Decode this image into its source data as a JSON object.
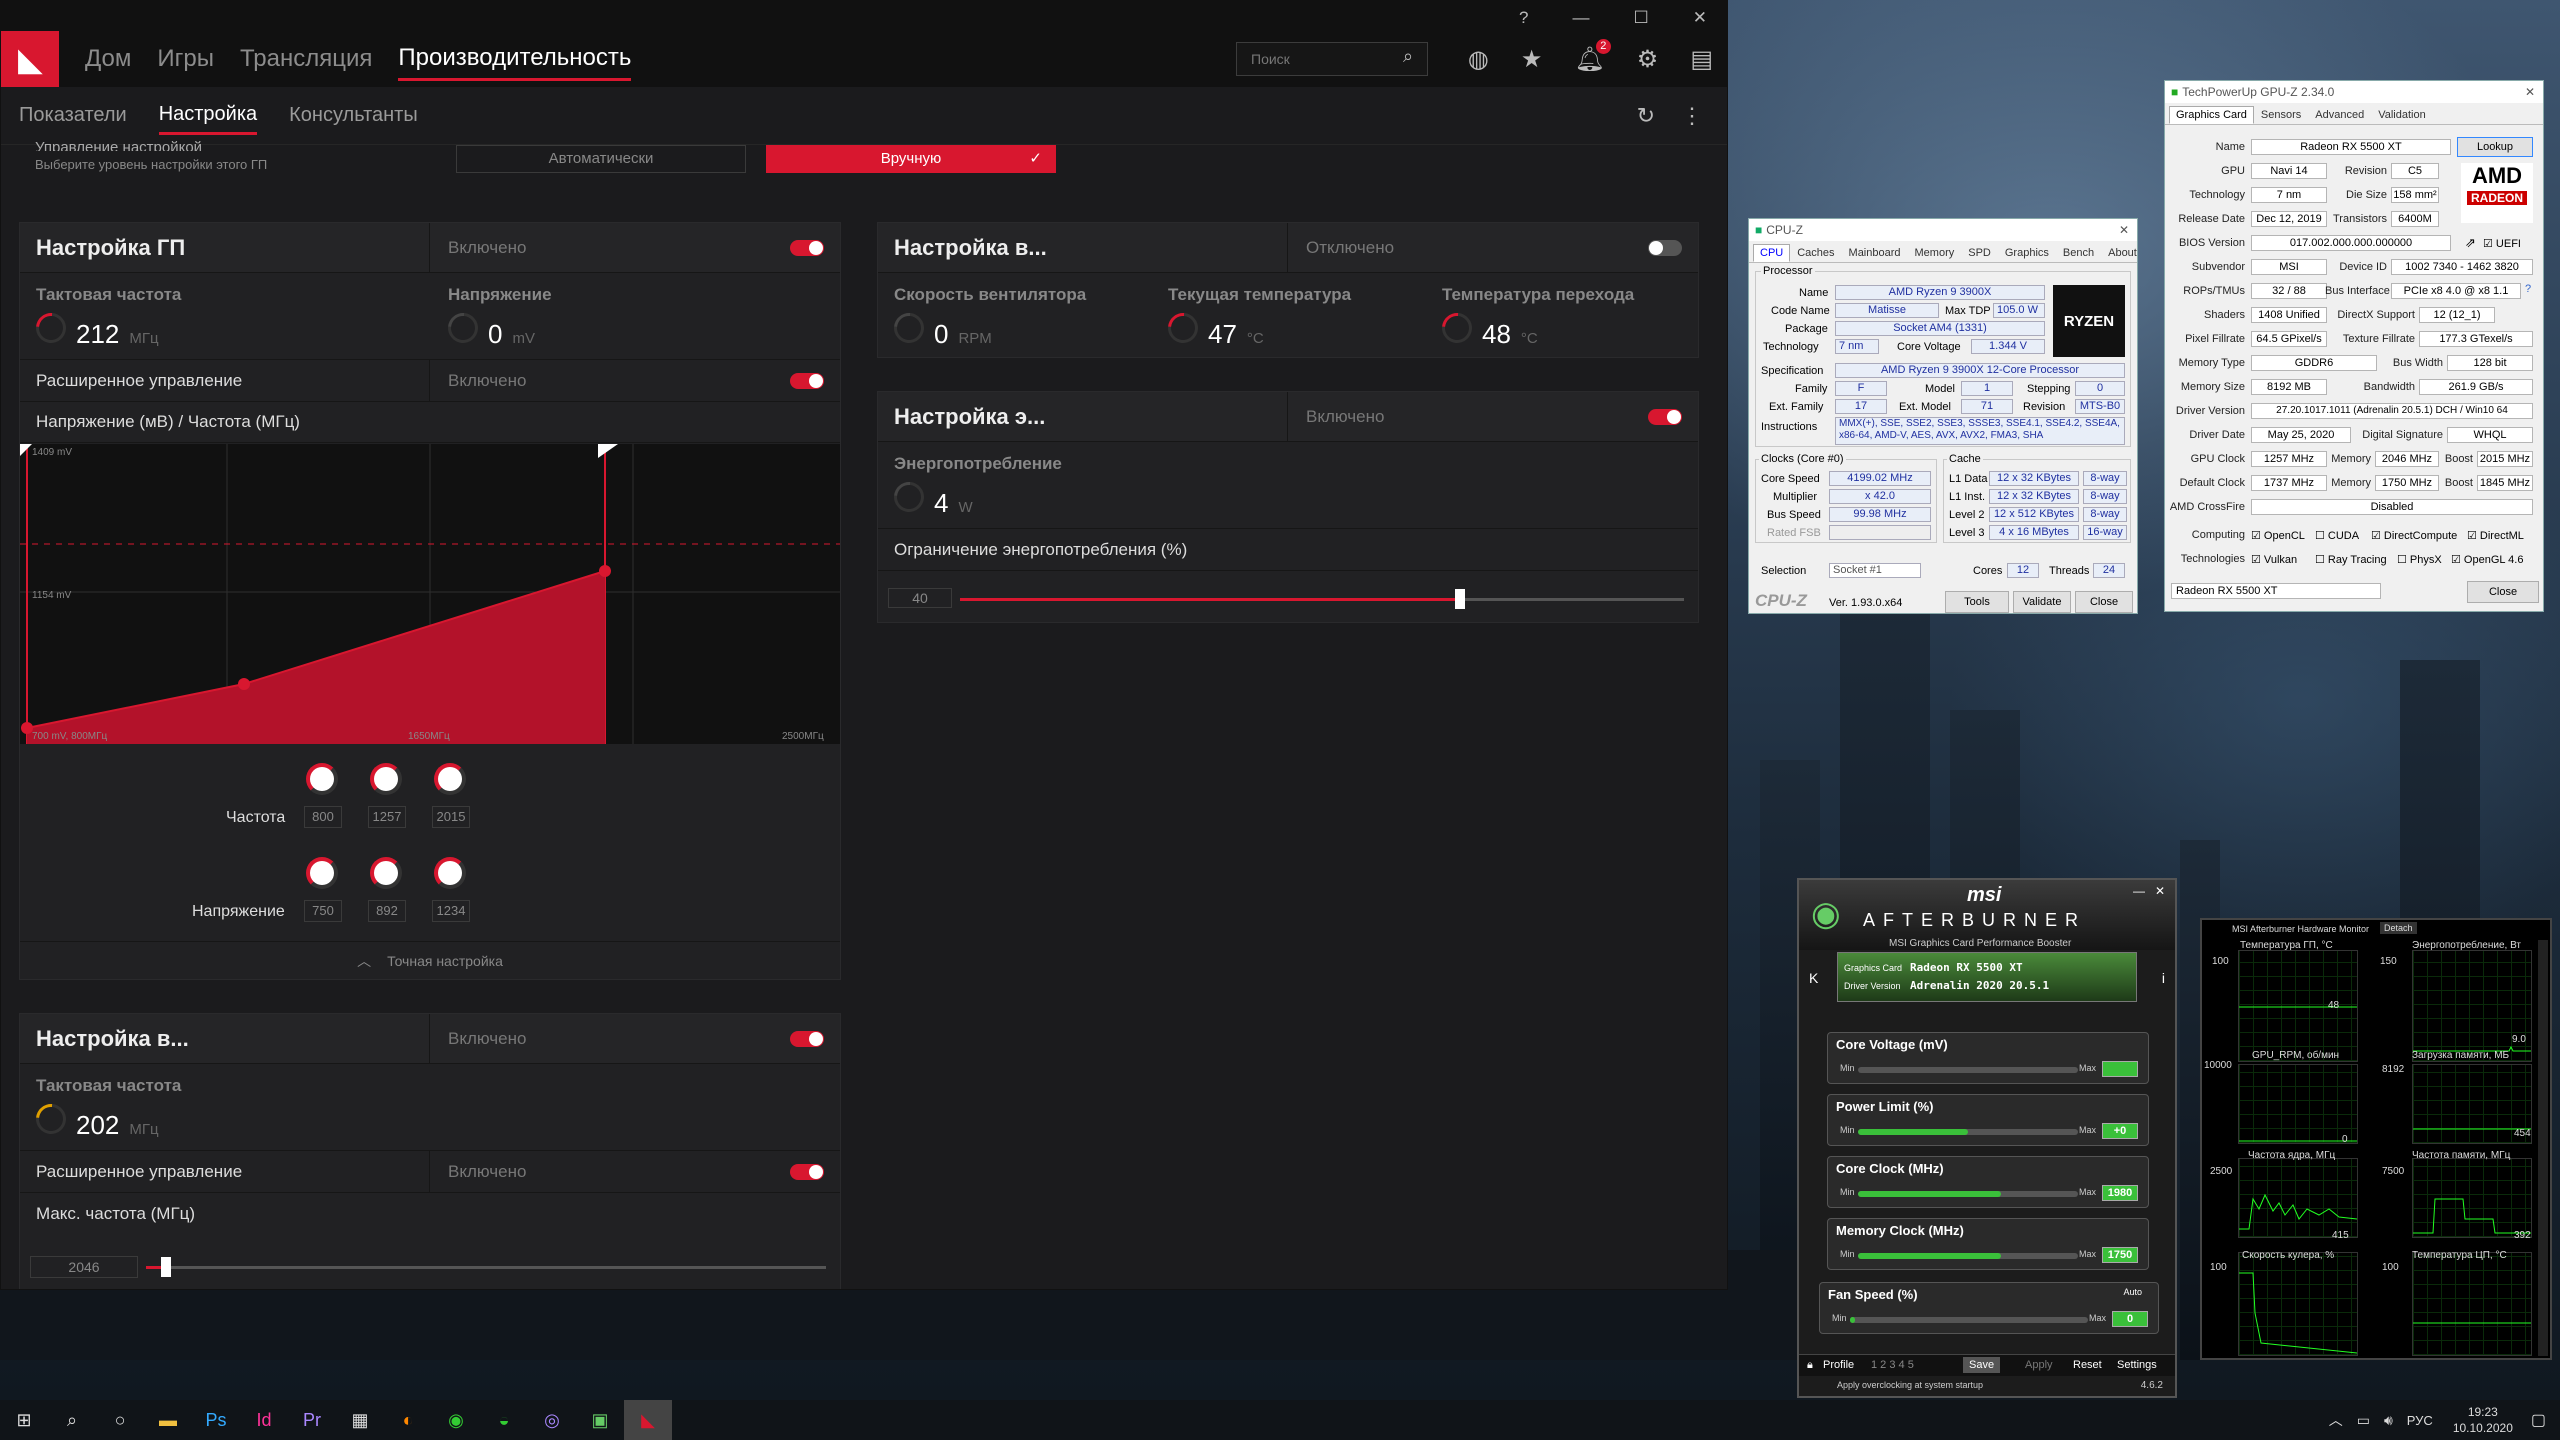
{
  "amd": {
    "nav": {
      "home": "Дом",
      "games": "Игры",
      "stream": "Трансляция",
      "perf": "Производительность",
      "search_placeholder": "Поиск",
      "notif_count": "2"
    },
    "sub": {
      "metrics": "Показатели",
      "tuning": "Настройка",
      "advisors": "Консультанты"
    },
    "mode": {
      "label": "Управление настройкой",
      "hint": "Выберите уровень настройки этого ГП",
      "auto": "Автоматически",
      "manual": "Вручную"
    },
    "gpu": {
      "title": "Настройка ГП",
      "status": "Включено",
      "clock_label": "Тактовая частота",
      "clock_val": "212",
      "clock_unit": "МГц",
      "volt_label": "Напряжение",
      "volt_val": "0",
      "volt_unit": "mV",
      "adv_label": "Расширенное управление",
      "adv_status": "Включено",
      "curve_label": "Напряжение (мВ) / Частота (МГц)",
      "y_top": "1409 mV",
      "y_mid": "1154 mV",
      "x_left": "700 mV, 800МГц",
      "x_mid": "1650МГц",
      "x_right": "2500МГц",
      "freq_label": "Частота",
      "freq_vals": [
        "800",
        "1257",
        "2015"
      ],
      "volt_row_label": "Напряжение",
      "volt_vals": [
        "750",
        "892",
        "1234"
      ],
      "fine": "Точная настройка"
    },
    "fan": {
      "title": "Настройка в...",
      "status": "Отключено",
      "speed_label": "Скорость вентилятора",
      "speed_val": "0",
      "speed_unit": "RPM",
      "temp_label": "Текущая температура",
      "temp_val": "47",
      "temp_unit": "°C",
      "junc_label": "Температура перехода",
      "junc_val": "48",
      "junc_unit": "°C"
    },
    "power": {
      "title": "Настройка э...",
      "status": "Включено",
      "usage_label": "Энергопотребление",
      "usage_val": "4",
      "usage_unit": "W",
      "limit_label": "Ограничение энергопотребления (%)",
      "limit_val": "40",
      "limit_fraction": 0.69
    },
    "vram": {
      "title": "Настройка в...",
      "status": "Включено",
      "clock_label": "Тактовая частота",
      "clock_val": "202",
      "clock_unit": "МГц",
      "adv_label": "Расширенное управление",
      "adv_status": "Включено",
      "max_label": "Макс. частота (МГц)",
      "max_val": "2046",
      "max_fraction": 0.03
    }
  },
  "cpuz": {
    "title": "CPU-Z",
    "tabs": [
      "CPU",
      "Caches",
      "Mainboard",
      "Memory",
      "SPD",
      "Graphics",
      "Bench",
      "About"
    ],
    "processor": "Processor",
    "name_l": "Name",
    "name": "AMD Ryzen 9 3900X",
    "code_l": "Code Name",
    "code": "Matisse",
    "tdp_l": "Max TDP",
    "tdp": "105.0 W",
    "pkg_l": "Package",
    "pkg": "Socket AM4 (1331)",
    "tech_l": "Technology",
    "tech": "7 nm",
    "cv_l": "Core Voltage",
    "cv": "1.344 V",
    "spec_l": "Specification",
    "spec": "AMD Ryzen 9 3900X 12-Core Processor",
    "fam_l": "Family",
    "fam": "F",
    "model_l": "Model",
    "model": "1",
    "step_l": "Stepping",
    "step": "0",
    "efam_l": "Ext. Family",
    "efam": "17",
    "emodel_l": "Ext. Model",
    "emodel": "71",
    "rev_l": "Revision",
    "rev": "MTS-B0",
    "inst_l": "Instructions",
    "inst": "MMX(+), SSE, SSE2, SSE3, SSSE3, SSE4.1, SSE4.2, SSE4A, x86-64, AMD-V, AES, AVX, AVX2, FMA3, SHA",
    "clocks": "Clocks (Core #0)",
    "cs_l": "Core Speed",
    "cs": "4199.02 MHz",
    "mul_l": "Multiplier",
    "mul": "x 42.0",
    "bus_l": "Bus Speed",
    "bus": "99.98 MHz",
    "fsb_l": "Rated FSB",
    "cache": "Cache",
    "l1d_l": "L1 Data",
    "l1d": "12 x 32 KBytes",
    "l1d_w": "8-way",
    "l1i_l": "L1 Inst.",
    "l1i": "12 x 32 KBytes",
    "l1i_w": "8-way",
    "l2_l": "Level 2",
    "l2": "12 x 512 KBytes",
    "l2_w": "8-way",
    "l3_l": "Level 3",
    "l3": "4 x 16 MBytes",
    "l3_w": "16-way",
    "sel_l": "Selection",
    "sel": "Socket #1",
    "cores_l": "Cores",
    "cores": "12",
    "thr_l": "Threads",
    "thr": "24",
    "ver": "Ver. 1.93.0.x64",
    "tools": "Tools",
    "validate": "Validate",
    "close": "Close",
    "brand": "CPU-Z",
    "logo": "RYZEN"
  },
  "gpuz": {
    "title": "TechPowerUp GPU-Z 2.34.0",
    "tabs": [
      "Graphics Card",
      "Sensors",
      "Advanced",
      "Validation"
    ],
    "name_l": "Name",
    "name": "Radeon RX 5500 XT",
    "lookup": "Lookup",
    "gpu_l": "GPU",
    "gpu": "Navi 14",
    "rev_l": "Revision",
    "rev": "C5",
    "tech_l": "Technology",
    "tech": "7 nm",
    "die_l": "Die Size",
    "die": "158 mm²",
    "rel_l": "Release Date",
    "rel": "Dec 12, 2019",
    "tr_l": "Transistors",
    "tr": "6400M",
    "bios_l": "BIOS Version",
    "bios": "017.002.000.000.000000",
    "uefi": "UEFI",
    "sub_l": "Subvendor",
    "sub": "MSI",
    "dev_l": "Device ID",
    "dev": "1002 7340 - 1462 3820",
    "rop_l": "ROPs/TMUs",
    "rop": "32 / 88",
    "bi_l": "Bus Interface",
    "bi": "PCIe x8 4.0 @ x8 1.1",
    "sh_l": "Shaders",
    "sh": "1408 Unified",
    "dx_l": "DirectX Support",
    "dx": "12 (12_1)",
    "pf_l": "Pixel Fillrate",
    "pf": "64.5 GPixel/s",
    "tf_l": "Texture Fillrate",
    "tf": "177.3 GTexel/s",
    "mt_l": "Memory Type",
    "mt": "GDDR6",
    "bw_l": "Bus Width",
    "bw": "128 bit",
    "ms_l": "Memory Size",
    "ms": "8192 MB",
    "band_l": "Bandwidth",
    "band": "261.9 GB/s",
    "dv_l": "Driver Version",
    "dv": "27.20.1017.1011 (Adrenalin 20.5.1) DCH / Win10 64",
    "dd_l": "Driver Date",
    "dd": "May 25, 2020",
    "sig_l": "Digital Signature",
    "sig": "WHQL",
    "gc_l": "GPU Clock",
    "gc": "1257 MHz",
    "mem_l": "Memory",
    "mem": "2046 MHz",
    "boost_l": "Boost",
    "boost": "2015 MHz",
    "dc_l": "Default Clock",
    "dc": "1737 MHz",
    "dmem": "1750 MHz",
    "dboost": "1845 MHz",
    "cf_l": "AMD CrossFire",
    "cf": "Disabled",
    "comp_l": "Computing",
    "comp": [
      "OpenCL",
      "CUDA",
      "DirectCompute",
      "DirectML"
    ],
    "techs_l": "Technologies",
    "techs": [
      "Vulkan",
      "Ray Tracing",
      "PhysX",
      "OpenGL 4.6"
    ],
    "card": "Radeon RX 5500 XT",
    "close": "Close",
    "logo1": "AMD",
    "logo2": "RADEON"
  },
  "ab": {
    "brand": "msi",
    "title": "AFTERBURNER",
    "subtitle": "MSI Graphics Card Performance Booster",
    "card_l": "Graphics Card",
    "card": "Radeon RX 5500 XT",
    "drv_l": "Driver Version",
    "drv": "Adrenalin 2020 20.5.1",
    "sliders": [
      {
        "label": "Core Voltage (mV)",
        "val": "",
        "fill": 0
      },
      {
        "label": "Power Limit (%)",
        "val": "+0",
        "fill": 0.5
      },
      {
        "label": "Core Clock (MHz)",
        "val": "1980",
        "fill": 0.65
      },
      {
        "label": "Memory Clock (MHz)",
        "val": "1750",
        "fill": 0.65
      },
      {
        "label": "Fan Speed (%)",
        "val": "0",
        "fill": 0.02
      }
    ],
    "min": "Min",
    "max": "Max",
    "auto": "Auto",
    "profile": "Profile",
    "save": "Save",
    "apply": "Apply",
    "reset": "Reset",
    "settings": "Settings",
    "startup": "Apply overclocking at system startup",
    "version": "4.6.2"
  },
  "mon": {
    "title": "MSI Afterburner Hardware Monitor",
    "detach": "Detach",
    "g1": "Температура ГП, °C",
    "g2": "Энергопотребление, Вт",
    "g3": "GPU_RPM, об/мин",
    "g4": "Загрузка памяти, МБ",
    "g5": "Частота ядра, МГц",
    "g6": "Частота памяти, МГц",
    "g7": "Скорость кулера, %",
    "g8": "Температура ЦП, °C",
    "v1": "48",
    "v2": "9.0",
    "v3": "0",
    "v4": "454",
    "v5": "415",
    "v6": "392",
    "s100": "100",
    "s150": "150",
    "s10000": "10000",
    "s8192": "8192",
    "s0": "0",
    "s2500": "2500",
    "s7500": "7500"
  },
  "taskbar": {
    "lang": "РУС",
    "time": "19:23",
    "date": "10.10.2020"
  }
}
